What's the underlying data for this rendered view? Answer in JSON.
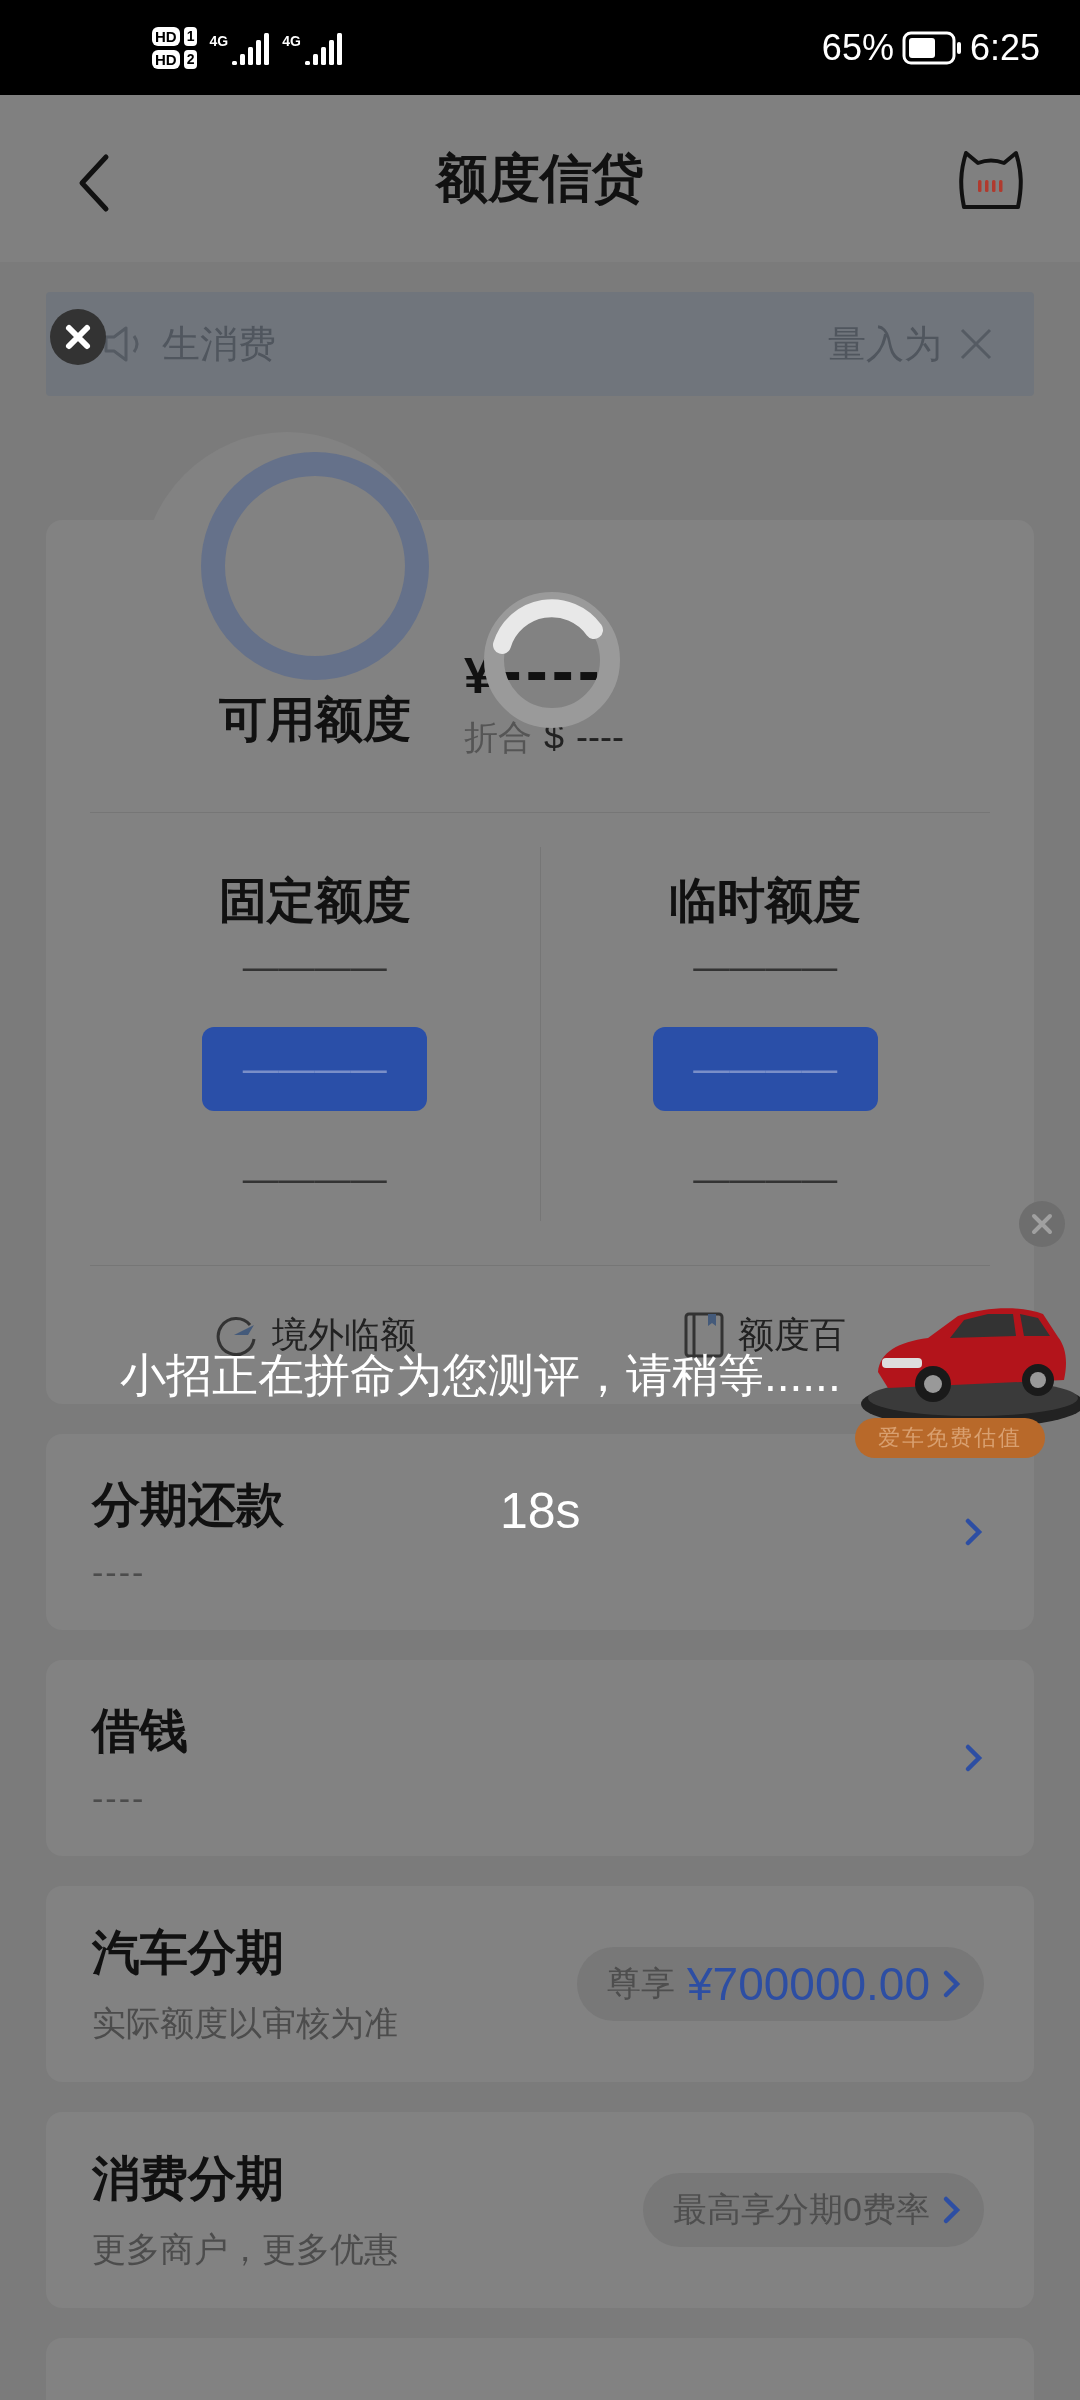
{
  "status_bar": {
    "sims": [
      {
        "label": "HD",
        "slot": "1",
        "net": "4G"
      },
      {
        "label": "HD",
        "slot": "2",
        "net": "4G"
      }
    ],
    "battery": "65%",
    "time": "6:25"
  },
  "header": {
    "title": "额度信贷"
  },
  "notice": {
    "left_text": "生消费",
    "right_text": "量入为"
  },
  "credit": {
    "label": "可用额度",
    "currency": "¥",
    "amount": "----",
    "converted_label": "折合",
    "converted_currency": "$",
    "converted_amount": "----"
  },
  "columns": [
    {
      "title": "固定额度",
      "value": "————",
      "button": "————",
      "note": "————"
    },
    {
      "title": "临时额度",
      "value": "————",
      "button": "————",
      "note": "————"
    }
  ],
  "links": [
    {
      "label": "境外临额",
      "kind": "plane"
    },
    {
      "label": "额度百",
      "kind": "book"
    }
  ],
  "rows": [
    {
      "title": "分期还款",
      "subtitle": "----",
      "kind": "arrow"
    },
    {
      "title": "借钱",
      "subtitle": "----",
      "kind": "arrow"
    },
    {
      "title": "汽车分期",
      "subtitle": "实际额度以审核为准",
      "kind": "pill",
      "pill_label": "尊享",
      "pill_value": "¥700000.00"
    },
    {
      "title": "消费分期",
      "subtitle": "更多商户，更多优惠",
      "kind": "pill",
      "pill_label": "最高享分期0费率"
    },
    {
      "kind": "cut"
    }
  ],
  "toast": {
    "message": "小招正在拼命为您测评，请稍等......",
    "countdown": "18s"
  },
  "car_ad": {
    "badge": "爱车免费估值"
  }
}
